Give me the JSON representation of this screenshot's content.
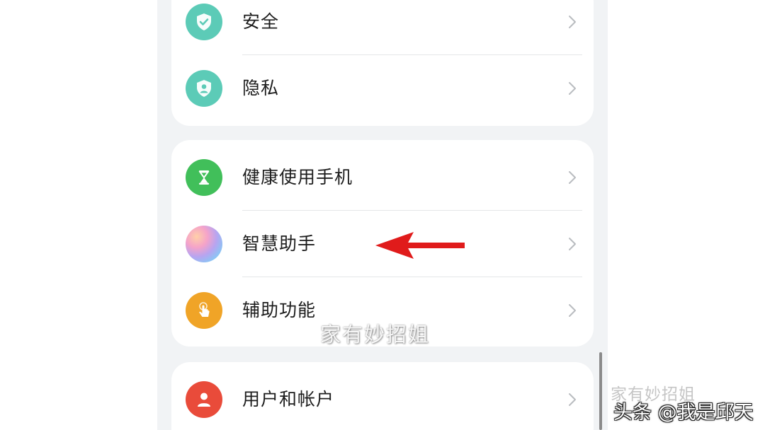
{
  "groups": [
    {
      "items": [
        {
          "label": "安全",
          "icon": "shield-check-icon"
        },
        {
          "label": "隐私",
          "icon": "shield-person-icon"
        }
      ]
    },
    {
      "items": [
        {
          "label": "健康使用手机",
          "icon": "hourglass-icon"
        },
        {
          "label": "智慧助手",
          "icon": "assistant-orb-icon"
        },
        {
          "label": "辅助功能",
          "icon": "hand-touch-icon"
        }
      ]
    },
    {
      "items": [
        {
          "label": "用户和帐户",
          "icon": "user-icon"
        }
      ]
    }
  ],
  "overlay": {
    "watermark": "家有妙招姐",
    "corner_mark": "家有妙招姐",
    "corner_credit": "头条 @我是邱天"
  },
  "colors": {
    "teal": "#5ccbb7",
    "green": "#41bf5a",
    "orange": "#f0a427",
    "red": "#e94b3a",
    "arrow": "#e01b1b"
  }
}
